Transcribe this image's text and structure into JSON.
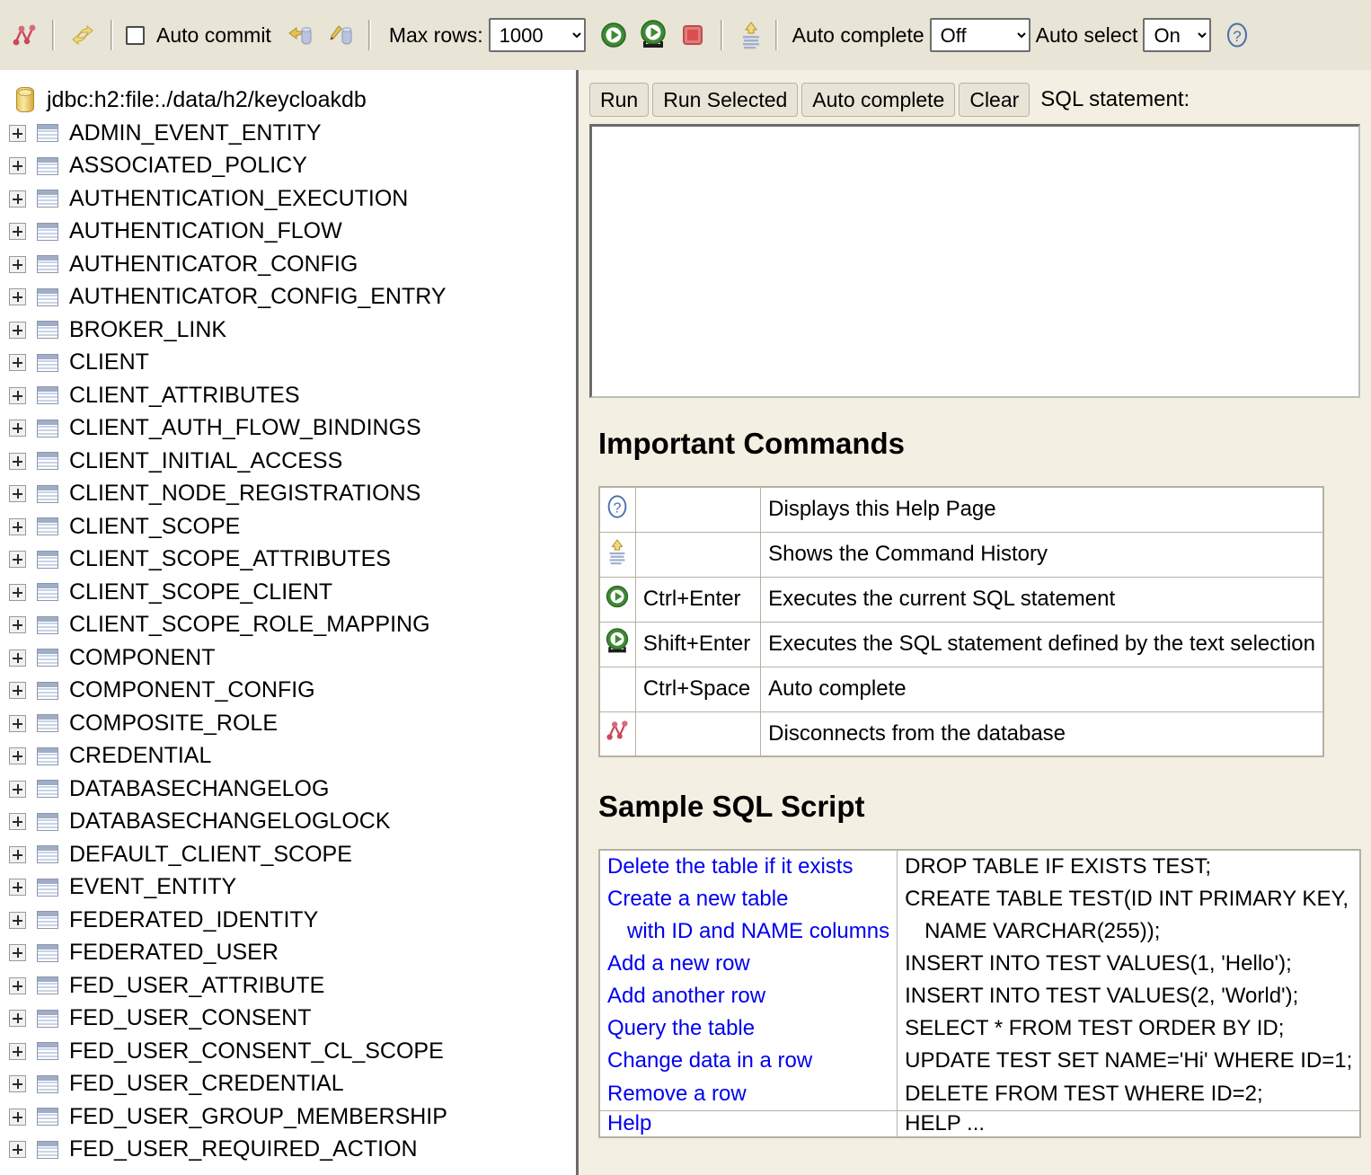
{
  "toolbar": {
    "disconnect_icon": "disconnect-icon",
    "refresh_icon": "refresh-icon",
    "auto_commit_label": "Auto commit",
    "auto_commit_checked": false,
    "rollback_icon": "rollback-icon",
    "commit_icon": "commit-icon",
    "max_rows_label": "Max rows:",
    "max_rows_value": "1000",
    "max_rows_options": [
      "1000"
    ],
    "run_icon": "run-icon",
    "run_selected_icon": "run-selected-icon",
    "stop_icon": "stop-icon",
    "history_icon": "history-icon",
    "auto_complete_label": "Auto complete",
    "auto_complete_value": "Off",
    "auto_complete_options": [
      "Off"
    ],
    "auto_select_label": "Auto select",
    "auto_select_value": "On",
    "auto_select_options": [
      "On"
    ],
    "help_icon": "help-icon"
  },
  "tree": {
    "root_label": "jdbc:h2:file:./data/h2/keycloakdb",
    "root_icon": "database-icon",
    "items": [
      {
        "label": "ADMIN_EVENT_ENTITY"
      },
      {
        "label": "ASSOCIATED_POLICY"
      },
      {
        "label": "AUTHENTICATION_EXECUTION"
      },
      {
        "label": "AUTHENTICATION_FLOW"
      },
      {
        "label": "AUTHENTICATOR_CONFIG"
      },
      {
        "label": "AUTHENTICATOR_CONFIG_ENTRY"
      },
      {
        "label": "BROKER_LINK"
      },
      {
        "label": "CLIENT"
      },
      {
        "label": "CLIENT_ATTRIBUTES"
      },
      {
        "label": "CLIENT_AUTH_FLOW_BINDINGS"
      },
      {
        "label": "CLIENT_INITIAL_ACCESS"
      },
      {
        "label": "CLIENT_NODE_REGISTRATIONS"
      },
      {
        "label": "CLIENT_SCOPE"
      },
      {
        "label": "CLIENT_SCOPE_ATTRIBUTES"
      },
      {
        "label": "CLIENT_SCOPE_CLIENT"
      },
      {
        "label": "CLIENT_SCOPE_ROLE_MAPPING"
      },
      {
        "label": "COMPONENT"
      },
      {
        "label": "COMPONENT_CONFIG"
      },
      {
        "label": "COMPOSITE_ROLE"
      },
      {
        "label": "CREDENTIAL"
      },
      {
        "label": "DATABASECHANGELOG"
      },
      {
        "label": "DATABASECHANGELOGLOCK"
      },
      {
        "label": "DEFAULT_CLIENT_SCOPE"
      },
      {
        "label": "EVENT_ENTITY"
      },
      {
        "label": "FEDERATED_IDENTITY"
      },
      {
        "label": "FEDERATED_USER"
      },
      {
        "label": "FED_USER_ATTRIBUTE"
      },
      {
        "label": "FED_USER_CONSENT"
      },
      {
        "label": "FED_USER_CONSENT_CL_SCOPE"
      },
      {
        "label": "FED_USER_CREDENTIAL"
      },
      {
        "label": "FED_USER_GROUP_MEMBERSHIP"
      },
      {
        "label": "FED_USER_REQUIRED_ACTION"
      }
    ]
  },
  "sql": {
    "run_label": "Run",
    "run_selected_label": "Run Selected",
    "auto_complete_label": "Auto complete",
    "clear_label": "Clear",
    "statement_label": "SQL statement:",
    "statement_value": "",
    "statement_placeholder": ""
  },
  "help": {
    "commands_title": "Important Commands",
    "commands": [
      {
        "icon": "help-icon",
        "key": "",
        "desc": "Displays this Help Page"
      },
      {
        "icon": "history-icon",
        "key": "",
        "desc": "Shows the Command History"
      },
      {
        "icon": "run-icon",
        "key": "Ctrl+Enter",
        "desc": "Executes the current SQL statement"
      },
      {
        "icon": "run-selected-icon",
        "key": "Shift+Enter",
        "desc": "Executes the SQL statement defined by the text selection"
      },
      {
        "icon": "",
        "key": "Ctrl+Space",
        "desc": "Auto complete"
      },
      {
        "icon": "disconnect-icon",
        "key": "",
        "desc": "Disconnects from the database"
      }
    ],
    "script_title": "Sample SQL Script",
    "script_rows": [
      {
        "desc_lines": [
          "Delete the table if it exists"
        ],
        "sql_lines": [
          "DROP TABLE IF EXISTS TEST;"
        ]
      },
      {
        "desc_lines": [
          "Create a new table",
          "with ID and NAME columns"
        ],
        "sql_lines": [
          "CREATE TABLE TEST(ID INT PRIMARY KEY,",
          "NAME VARCHAR(255));"
        ]
      },
      {
        "desc_lines": [
          "Add a new row"
        ],
        "sql_lines": [
          "INSERT INTO TEST VALUES(1, 'Hello');"
        ]
      },
      {
        "desc_lines": [
          "Add another row"
        ],
        "sql_lines": [
          "INSERT INTO TEST VALUES(2, 'World');"
        ]
      },
      {
        "desc_lines": [
          "Query the table"
        ],
        "sql_lines": [
          "SELECT * FROM TEST ORDER BY ID;"
        ]
      },
      {
        "desc_lines": [
          "Change data in a row"
        ],
        "sql_lines": [
          "UPDATE TEST SET NAME='Hi' WHERE ID=1;"
        ]
      },
      {
        "desc_lines": [
          "Remove a row"
        ],
        "sql_lines": [
          "DELETE FROM TEST WHERE ID=2;"
        ]
      }
    ],
    "script_help_row": {
      "desc": "Help",
      "sql": "HELP ..."
    }
  },
  "colors": {
    "toolbar_bg": "#e8e4d6",
    "right_panel_bg": "#f3efe2",
    "tree_bg": "#ffffff",
    "link_blue": "#0000ee",
    "run_green": "#3e8a34",
    "stop_red": "#d94f4f",
    "disconnect_red": "#c9485a",
    "refresh_gold": "#e0b84a"
  }
}
